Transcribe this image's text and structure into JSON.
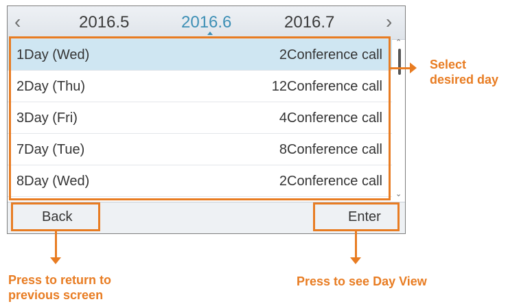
{
  "month_nav": {
    "prev_icon": "chevron-left-icon",
    "next_icon": "chevron-right-icon",
    "months": [
      "2016.5",
      "2016.6",
      "2016.7"
    ],
    "current_index": 1
  },
  "days": [
    {
      "day": "1Day (Wed)",
      "calls": "2Conference call",
      "selected": true
    },
    {
      "day": "2Day (Thu)",
      "calls": "12Conference call",
      "selected": false
    },
    {
      "day": "3Day (Fri)",
      "calls": "4Conference call",
      "selected": false
    },
    {
      "day": "7Day (Tue)",
      "calls": "8Conference call",
      "selected": false
    },
    {
      "day": "8Day (Wed)",
      "calls": "2Conference call",
      "selected": false
    }
  ],
  "softkeys": {
    "back": "Back",
    "enter": "Enter"
  },
  "annotations": {
    "select_line1": "Select",
    "select_line2": "desired day",
    "back_line1": "Press to return to",
    "back_line2": "previous screen",
    "enter": "Press to see Day View"
  },
  "colors": {
    "accent": "#e87c22",
    "selected_row": "#cfe6f2",
    "current_month": "#3d8fb5"
  }
}
